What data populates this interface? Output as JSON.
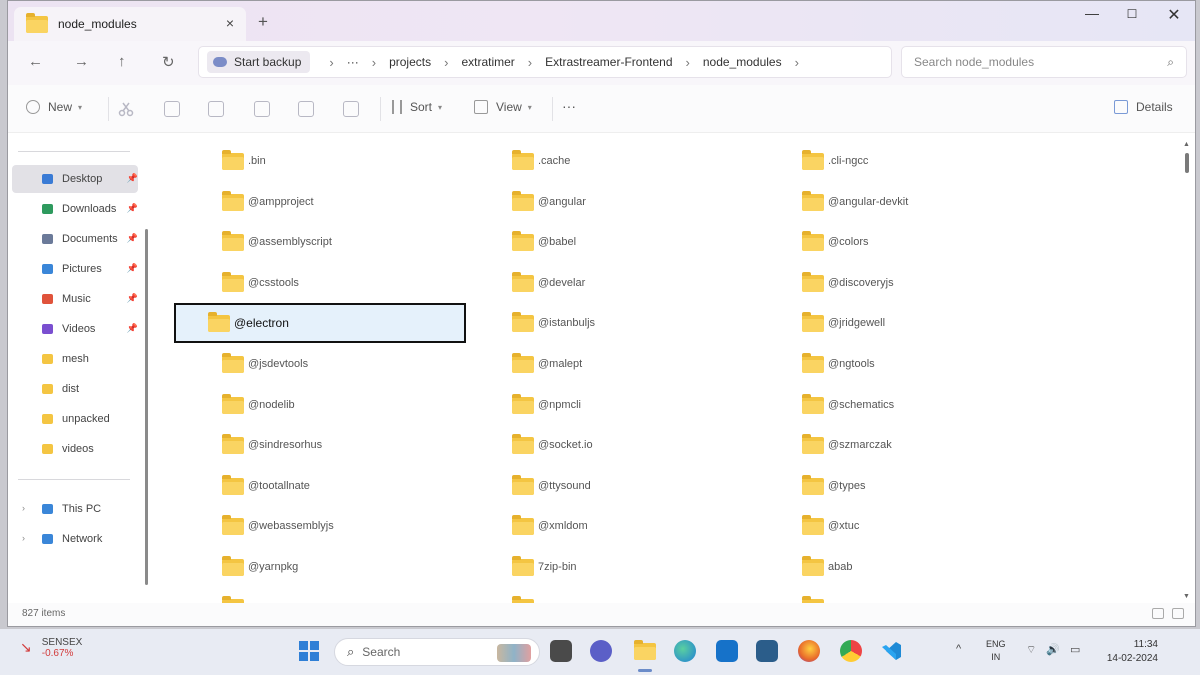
{
  "tab": {
    "title": "node_modules",
    "close": "×",
    "new_tab": "+"
  },
  "window_controls": {
    "minimize": "—",
    "maximize": "☐",
    "close": "✕"
  },
  "nav": {
    "back": "←",
    "forward": "→",
    "up": "↑",
    "refresh": "↻"
  },
  "address": {
    "backup_label": "Start backup",
    "ellipsis": "···",
    "breadcrumbs": [
      "projects",
      "extratimer",
      "Extrastreamer-Frontend",
      "node_modules"
    ]
  },
  "search": {
    "placeholder": "Search node_modules",
    "icon": "⌕"
  },
  "toolbar": {
    "new_label": "New",
    "sort_label": "Sort",
    "view_label": "View",
    "more_label": "···",
    "details_label": "Details"
  },
  "sidebar": {
    "pinned": [
      {
        "label": "Desktop",
        "icon": "desktop-icon",
        "color": "#3a7bd5",
        "pinned": true,
        "active": true
      },
      {
        "label": "Downloads",
        "icon": "download-icon",
        "color": "#2e9a5e",
        "pinned": true
      },
      {
        "label": "Documents",
        "icon": "document-icon",
        "color": "#6b7a99",
        "pinned": true
      },
      {
        "label": "Pictures",
        "icon": "pictures-icon",
        "color": "#3a86d8",
        "pinned": true
      },
      {
        "label": "Music",
        "icon": "music-icon",
        "color": "#e0533b",
        "pinned": true
      },
      {
        "label": "Videos",
        "icon": "videos-icon",
        "color": "#7a4fd0",
        "pinned": true
      },
      {
        "label": "mesh",
        "icon": "folder-icon",
        "color": "#f4c542"
      },
      {
        "label": "dist",
        "icon": "folder-icon",
        "color": "#f4c542"
      },
      {
        "label": "unpacked",
        "icon": "folder-icon",
        "color": "#f4c542"
      },
      {
        "label": "videos",
        "icon": "folder-icon",
        "color": "#f4c542"
      }
    ],
    "locations": [
      {
        "label": "This PC",
        "icon": "computer-icon",
        "color": "#3a86d8"
      },
      {
        "label": "Network",
        "icon": "network-icon",
        "color": "#3a86d8"
      }
    ]
  },
  "folders": [
    [
      ".bin",
      "@ampproject",
      "@assemblyscript",
      "@csstools",
      "@electron",
      "@jsdevtools",
      "@nodelib",
      "@sindresorhus",
      "@tootallnate",
      "@webassemblyjs",
      "@yarnpkg"
    ],
    [
      ".cache",
      "@angular",
      "@babel",
      "@develar",
      "@istanbuljs",
      "@malept",
      "@npmcli",
      "@socket.io",
      "@ttysound",
      "@xmldom",
      "7zip-bin"
    ],
    [
      ".cli-ngcc",
      "@angular-devkit",
      "@colors",
      "@discoveryjs",
      "@jridgewell",
      "@ngtools",
      "@schematics",
      "@szmarczak",
      "@types",
      "@xtuc",
      "abab"
    ]
  ],
  "selected_folder": "@electron",
  "status": {
    "item_count": "827 items"
  },
  "taskbar": {
    "stock_name": "SENSEX",
    "stock_change": "-0.67%",
    "stock_arrow": "↘",
    "search_placeholder": "Search",
    "search_icon": "⌕",
    "apps": [
      {
        "name": "start-button",
        "color": "#2f7fd6"
      },
      {
        "name": "file-manager-app",
        "color": "#555555"
      },
      {
        "name": "chat-app",
        "color": "#5b5fc7"
      },
      {
        "name": "file-explorer-app",
        "color": "#f4c542"
      },
      {
        "name": "edge-browser",
        "color": "#1f9ad6"
      },
      {
        "name": "mail-app",
        "color": "#1672c9"
      },
      {
        "name": "photos-app",
        "color": "#2b5d8a"
      },
      {
        "name": "firefox-browser",
        "color": "#e8692a"
      },
      {
        "name": "chrome-browser",
        "color": "#3aa757"
      },
      {
        "name": "vscode-app",
        "color": "#1e8ad6"
      }
    ],
    "tray_chevron": "^",
    "lang_top": "ENG",
    "lang_bottom": "IN",
    "tray_icons": [
      "⌔",
      "🔊",
      "▭"
    ],
    "time": "11:34",
    "date": "14-02-2024"
  }
}
